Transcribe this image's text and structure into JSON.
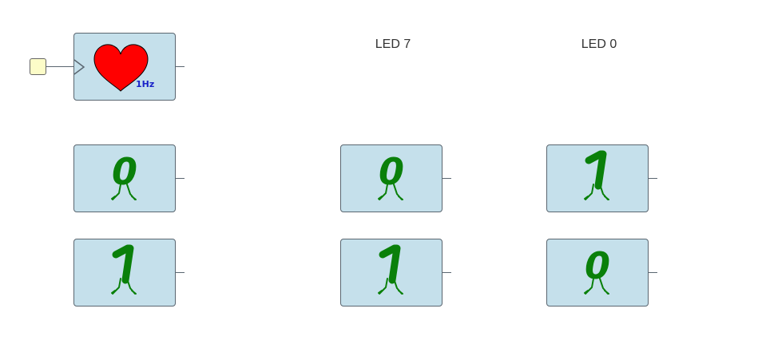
{
  "clock": {
    "frequency_label": "1Hz",
    "heart_color": "#ff0000"
  },
  "labels": {
    "led7": "LED 7",
    "led0": "LED 0"
  },
  "bits": {
    "left_top": "0",
    "left_bottom": "1",
    "mid_top": "0",
    "mid_bottom": "1",
    "right_top": "1",
    "right_bottom": "0"
  },
  "colors": {
    "block_fill": "#c5e0eb",
    "digit_green": "#0a800a",
    "input_fill": "#fcfcc8",
    "freq_text": "#1a23c8"
  }
}
